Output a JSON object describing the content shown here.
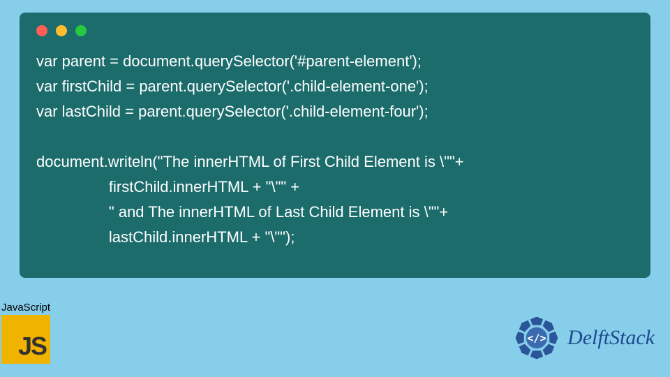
{
  "code": {
    "line1": "var parent = document.querySelector('#parent-element');",
    "line2": "var firstChild = parent.querySelector('.child-element-one');",
    "line3": "var lastChild = parent.querySelector('.child-element-four');",
    "line4": "",
    "line5": "document.writeln(\"The innerHTML of First Child Element is \\\"\"+",
    "line6": "                 firstChild.innerHTML + \"\\\"\" +",
    "line7": "                 \" and The innerHTML of Last Child Element is \\\"\"+",
    "line8": "                 lastChild.innerHTML + \"\\\"\");"
  },
  "js_badge": {
    "label": "JavaScript",
    "logo_text": "JS"
  },
  "brand": {
    "name": "DelftStack"
  },
  "colors": {
    "page_bg": "#87ceeb",
    "window_bg": "#1c6c6c",
    "code_text": "#ffffff",
    "js_bg": "#f0b400",
    "brand_color": "#1e4b8e"
  }
}
